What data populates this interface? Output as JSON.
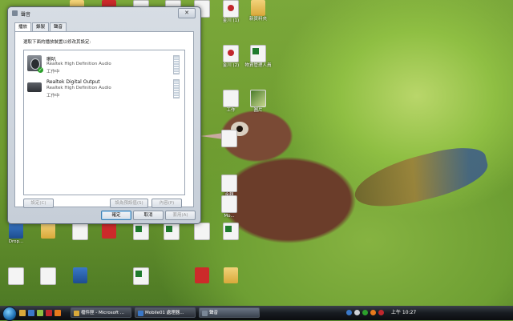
{
  "desktop": {
    "watermark": "#468330",
    "icons": [
      {
        "label": "",
        "kind": "folder"
      },
      {
        "label": "",
        "kind": "red"
      },
      {
        "label": "",
        "kind": "doc"
      },
      {
        "label": "",
        "kind": "doc"
      },
      {
        "label": "",
        "kind": "doc"
      },
      {
        "label": "金川 (1)",
        "kind": "pdf"
      },
      {
        "label": "新資料夾",
        "kind": "folder"
      },
      {
        "label": "金川 (2)",
        "kind": "pdf"
      },
      {
        "label": "物資管理人員",
        "kind": "xls"
      },
      {
        "label": "工作",
        "kind": "doc"
      },
      {
        "label": "圖片",
        "kind": "img"
      },
      {
        "label": "",
        "kind": "doc"
      },
      {
        "label": "金額",
        "kind": "doc"
      },
      {
        "label": "",
        "kind": "doc"
      },
      {
        "label": "Mo...",
        "kind": "doc"
      },
      {
        "label": "Drop...",
        "kind": "app"
      },
      {
        "label": "",
        "kind": "folder"
      },
      {
        "label": "",
        "kind": "doc"
      },
      {
        "label": "",
        "kind": "red"
      },
      {
        "label": "",
        "kind": "xls"
      },
      {
        "label": "",
        "kind": "xls"
      },
      {
        "label": "",
        "kind": "doc"
      },
      {
        "label": "",
        "kind": "xls"
      },
      {
        "label": "",
        "kind": "doc"
      },
      {
        "label": "",
        "kind": "doc"
      },
      {
        "label": "",
        "kind": "app"
      },
      {
        "label": "",
        "kind": "xls"
      },
      {
        "label": "",
        "kind": "red"
      },
      {
        "label": "",
        "kind": "folder"
      }
    ]
  },
  "dialog": {
    "title": "聲音",
    "close_symbol": "✕",
    "tabs": [
      "播放",
      "錄製",
      "聲音"
    ],
    "active_tab": 0,
    "instructions": "選取下面的播放裝置以修改其設定:",
    "devices": [
      {
        "name": "喇叭",
        "description": "Realtek High Definition Audio",
        "status": "工作中",
        "is_default": true,
        "icon": "speaker-icon"
      },
      {
        "name": "Realtek Digital Output",
        "description": "Realtek High Definition Audio",
        "status": "工作中",
        "is_default": false,
        "icon": "digital-output-icon"
      }
    ],
    "buttons": {
      "configure": "設定(C)",
      "set_default": "設為預設值(S)",
      "properties": "內容(P)",
      "ok": "確定",
      "cancel": "取消",
      "apply": "套用(A)"
    }
  },
  "taskbar": {
    "items": [
      {
        "label": "檔件匣 - Microsoft ..."
      },
      {
        "label": "Mobile01 處理器..."
      },
      {
        "label": "聲音"
      }
    ],
    "active_index": 2,
    "clock": "上午 10:27"
  },
  "colors": {
    "accent": "#3c7fb1",
    "ok_check": "#2ca02c"
  }
}
